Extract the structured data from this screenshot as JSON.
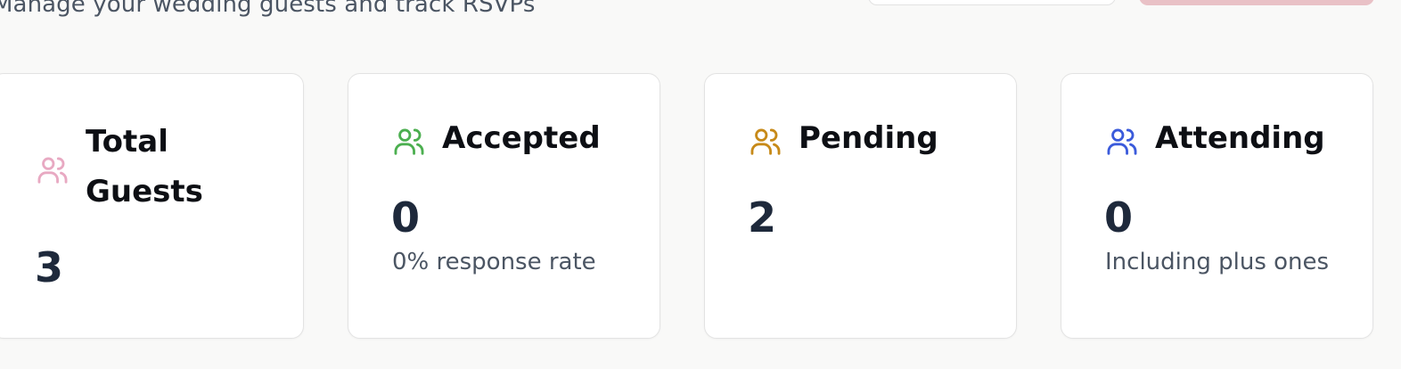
{
  "header": {
    "subtitle": "Manage your wedding guests and track RSVPs"
  },
  "colors": {
    "pink": "#e8a9c2",
    "green": "#4caf50",
    "amber": "#c78a19",
    "blue": "#3b5bdb"
  },
  "stats": [
    {
      "icon": "users-icon",
      "title": "Total Guests",
      "value": "3",
      "note": ""
    },
    {
      "icon": "users-icon",
      "title": "Accepted",
      "value": "0",
      "note": "0% response rate"
    },
    {
      "icon": "users-icon",
      "title": "Pending",
      "value": "2",
      "note": ""
    },
    {
      "icon": "users-icon",
      "title": "Attending",
      "value": "0",
      "note": "Including plus ones"
    }
  ]
}
